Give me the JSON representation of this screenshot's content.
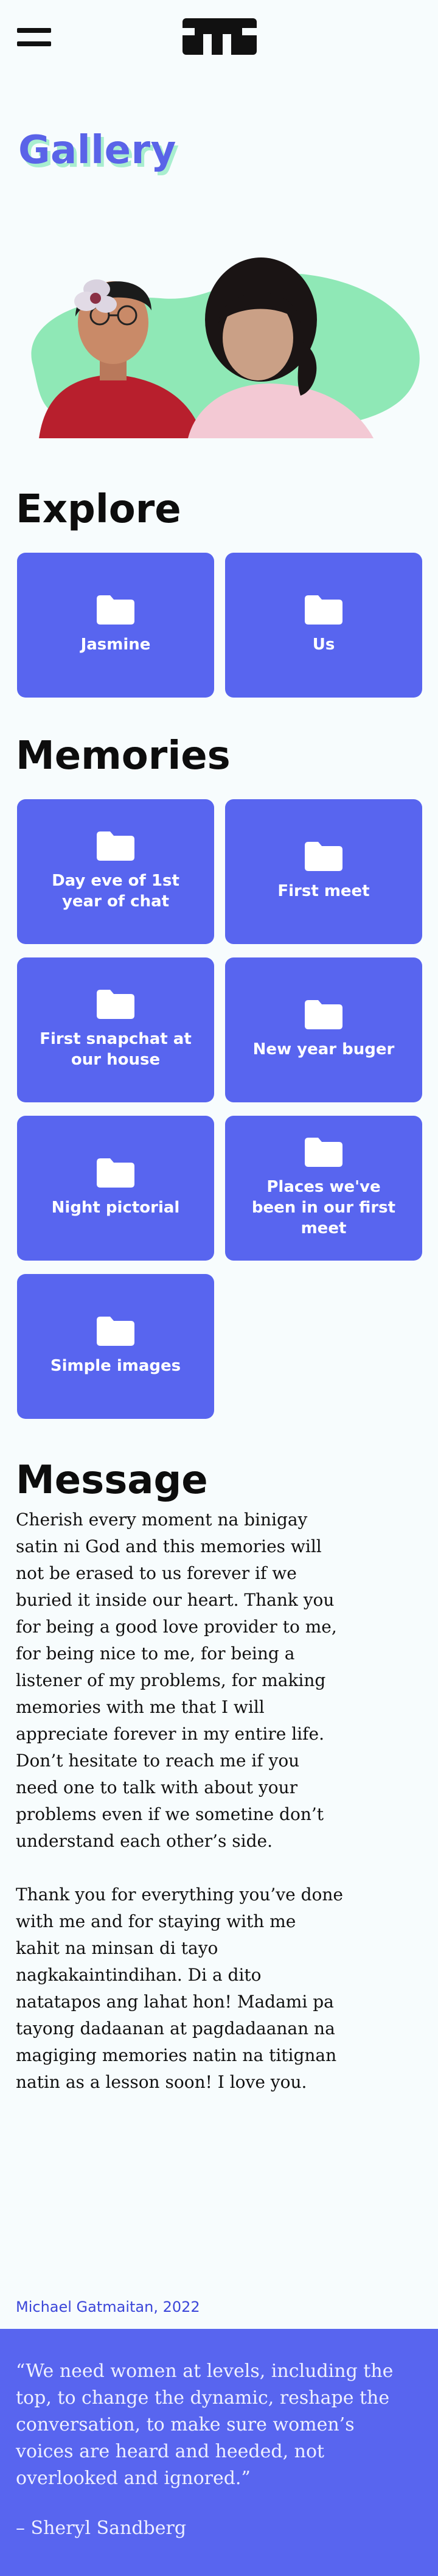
{
  "nav": {
    "menu_icon": "hamburger-menu-icon",
    "logo_icon": "site-logo-icon"
  },
  "gallery": {
    "title": "Gallery"
  },
  "explore": {
    "heading": "Explore",
    "cards": [
      {
        "label": "Jasmine",
        "icon": "folder-icon"
      },
      {
        "label": "Us",
        "icon": "folder-icon"
      }
    ]
  },
  "memories": {
    "heading": "Memories",
    "cards": [
      {
        "label": "Day eve of 1st year of chat",
        "icon": "folder-icon"
      },
      {
        "label": "First meet",
        "icon": "folder-icon"
      },
      {
        "label": "First snapchat at our house",
        "icon": "folder-icon"
      },
      {
        "label": "New year buger",
        "icon": "folder-icon"
      },
      {
        "label": "Night pictorial",
        "icon": "folder-icon"
      },
      {
        "label": "Places we've been in our first meet",
        "icon": "folder-icon"
      },
      {
        "label": "Simple images",
        "icon": "folder-icon"
      }
    ]
  },
  "message": {
    "heading": "Message",
    "paragraphs": [
      "Cherish every moment na binigay satin ni God and this memories will not be erased to us forever if we buried it inside our heart. Thank you for being a good love provider to me, for being nice to me, for being a listener of my problems, for making memories with me that I will appreciate forever in my entire life. Don’t hesitate to reach me if you need one to talk with about your problems even if we sometine don’t understand each other’s side.",
      "Thank you for everything you’ve done with me and for staying with me kahit na minsan di tayo nagkakaintindihan. Di a dito natatapos ang lahat hon! Madami pa tayong dadaanan at pagdadaanan na magiging memories natin na titignan natin as a lesson soon! I love you."
    ]
  },
  "footer": {
    "credit": "Michael Gatmaitan, 2022",
    "quote": "“We need women at levels, including the top, to change the dynamic, reshape the conversation, to make sure women’s voices are heard and heeded, not overlooked and ignored.”",
    "author": "– Sheryl Sandberg"
  },
  "colors": {
    "accent": "#5865ef",
    "title": "#5a63e8",
    "title_shadow": "#a9eecf",
    "hero_blob": "#8fe8b6",
    "background": "#f7fcfd"
  }
}
